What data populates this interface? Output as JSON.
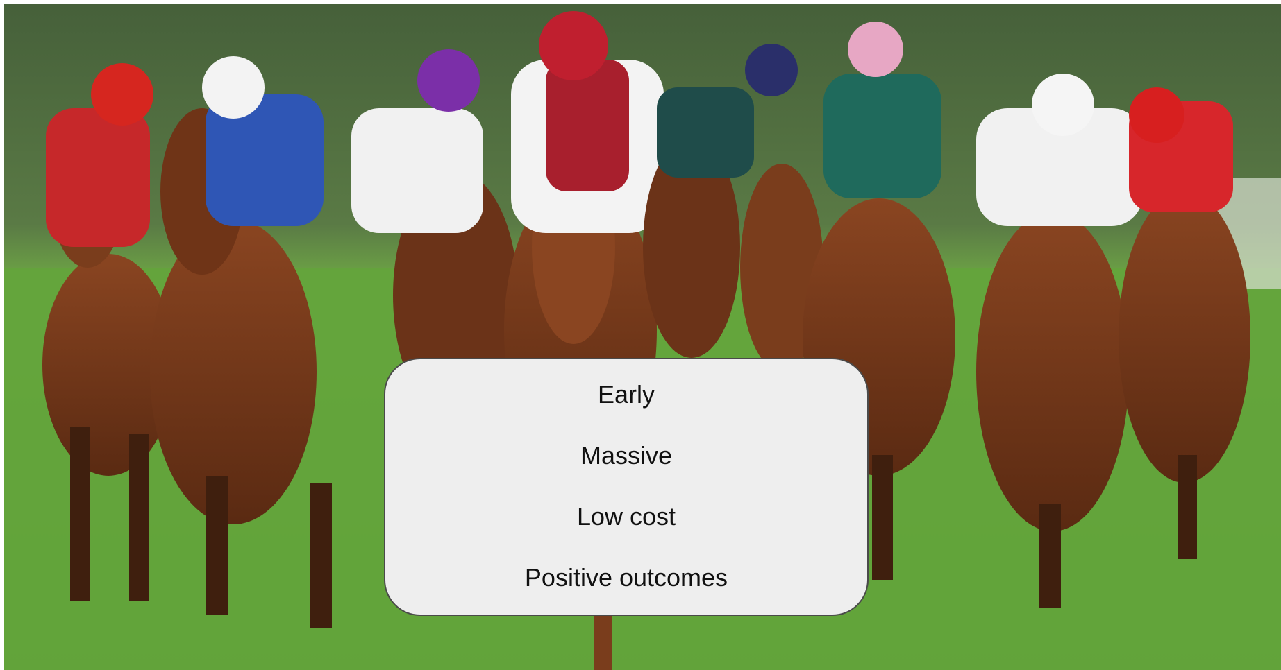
{
  "slide": {
    "background_image": {
      "subject": "horse-race-photo",
      "colors": {
        "sky": "#4e6b3c",
        "turf": "#5fa43a",
        "horse": "#7a3d1c",
        "horse_dark": "#3f1f0e"
      }
    },
    "callout": {
      "colors": {
        "fill": "#eeeeee",
        "border": "#4a4a4a",
        "text": "#111111"
      },
      "lines": [
        "Early",
        "Massive",
        "Low cost",
        "Positive outcomes"
      ]
    }
  }
}
